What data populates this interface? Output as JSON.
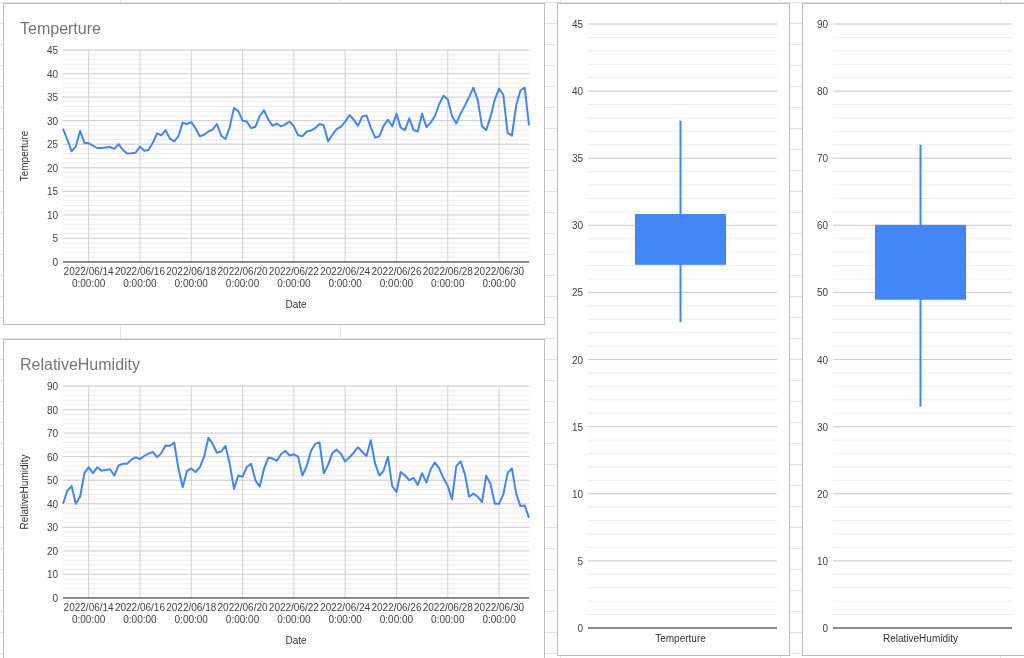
{
  "charts": [
    {
      "chart_data": {
        "type": "line",
        "grid": true,
        "title": "Temperture",
        "xlabel": "Date",
        "ylabel": "Temperture",
        "categories": [
          null,
          null,
          null,
          null,
          null,
          null,
          "2022/06/14 0:00:00",
          null,
          null,
          null,
          null,
          null,
          null,
          null,
          null,
          null,
          null,
          null,
          "2022/06/16 0:00:00",
          null,
          null,
          null,
          null,
          null,
          null,
          null,
          null,
          null,
          null,
          null,
          "2022/06/18 0:00:00",
          null,
          null,
          null,
          null,
          null,
          null,
          null,
          null,
          null,
          null,
          null,
          "2022/06/20 0:00:00",
          null,
          null,
          null,
          null,
          null,
          null,
          null,
          null,
          null,
          null,
          null,
          "2022/06/22 0:00:00",
          null,
          null,
          null,
          null,
          null,
          null,
          null,
          null,
          null,
          null,
          null,
          "2022/06/24 0:00:00",
          null,
          null,
          null,
          null,
          null,
          null,
          null,
          null,
          null,
          null,
          null,
          "2022/06/26 0:00:00",
          null,
          null,
          null,
          null,
          null,
          null,
          null,
          null,
          null,
          null,
          null,
          "2022/06/28 0:00:00",
          null,
          null,
          null,
          null,
          null,
          null,
          null,
          null,
          null,
          null,
          null,
          "2022/06/30 0:00:00",
          null,
          null,
          null,
          null,
          null,
          null,
          null
        ],
        "series": [
          {
            "color": "#4285f4",
            "values": [
              28.3,
              26,
              23.5,
              24.5,
              27.8,
              25.3,
              25.2,
              24.7,
              24.2,
              24.2,
              24.3,
              24.4,
              24,
              25,
              23.8,
              23,
              23.1,
              23.2,
              24.5,
              23.6,
              23.8,
              25.3,
              27.3,
              26.9,
              28,
              26.2,
              25.6,
              26.7,
              29.6,
              29.3,
              29.7,
              28.4,
              26.7,
              27,
              27.7,
              28.1,
              29.3,
              26.8,
              26.1,
              28.6,
              32.7,
              32,
              30,
              29.8,
              28.4,
              28.7,
              31,
              32.2,
              30.3,
              28.9,
              29.4,
              28.8,
              29.2,
              29.8,
              28.8,
              26.9,
              26.7,
              27.7,
              27.9,
              28.4,
              29.3,
              29,
              25.6,
              27,
              28.2,
              28.7,
              29.8,
              31.2,
              30.2,
              28.9,
              30.9,
              31.1,
              28.5,
              26.4,
              26.7,
              28.9,
              30.2,
              28.8,
              31.5,
              28.5,
              28,
              30.5,
              28,
              27.7,
              31.5,
              28.6,
              29.6,
              31,
              33.5,
              35.3,
              34.5,
              31,
              29.4,
              31.5,
              33.2,
              35,
              37,
              34.4,
              28.8,
              28,
              30.8,
              34.5,
              36.8,
              35.5,
              27.4,
              26.8,
              33.2,
              36.4,
              37,
              29
            ]
          }
        ],
        "ylim": [
          0,
          45
        ],
        "yticks": [
          0,
          5,
          10,
          15,
          20,
          25,
          30,
          35,
          40,
          45
        ]
      }
    },
    {
      "chart_data": {
        "type": "line",
        "grid": true,
        "title": "RelativeHumidity",
        "xlabel": "Date",
        "ylabel": "RelativeHumidity",
        "categories": [
          null,
          null,
          null,
          null,
          null,
          null,
          "2022/06/14 0:00:00",
          null,
          null,
          null,
          null,
          null,
          null,
          null,
          null,
          null,
          null,
          null,
          "2022/06/16 0:00:00",
          null,
          null,
          null,
          null,
          null,
          null,
          null,
          null,
          null,
          null,
          null,
          "2022/06/18 0:00:00",
          null,
          null,
          null,
          null,
          null,
          null,
          null,
          null,
          null,
          null,
          null,
          "2022/06/20 0:00:00",
          null,
          null,
          null,
          null,
          null,
          null,
          null,
          null,
          null,
          null,
          null,
          "2022/06/22 0:00:00",
          null,
          null,
          null,
          null,
          null,
          null,
          null,
          null,
          null,
          null,
          null,
          "2022/06/24 0:00:00",
          null,
          null,
          null,
          null,
          null,
          null,
          null,
          null,
          null,
          null,
          null,
          "2022/06/26 0:00:00",
          null,
          null,
          null,
          null,
          null,
          null,
          null,
          null,
          null,
          null,
          null,
          "2022/06/28 0:00:00",
          null,
          null,
          null,
          null,
          null,
          null,
          null,
          null,
          null,
          null,
          null,
          "2022/06/30 0:00:00",
          null,
          null,
          null,
          null,
          null,
          null,
          null
        ],
        "series": [
          {
            "color": "#4285f4",
            "values": [
              40,
              45.5,
              47.5,
              40,
              43,
              53,
              55.5,
              53,
              55.5,
              54,
              54.3,
              54.7,
              52,
              56.3,
              57,
              57,
              58.7,
              59.7,
              59,
              60.3,
              61.3,
              62,
              59.8,
              61.5,
              64.7,
              64.6,
              66,
              55,
              47,
              54,
              55,
              53.5,
              55.4,
              60,
              68,
              65.5,
              61.7,
              62.2,
              64.6,
              57,
              46.3,
              52,
              51.5,
              55.6,
              57,
              50,
              47.3,
              54.7,
              59.5,
              59.2,
              58.3,
              61,
              62.5,
              60.5,
              61,
              60,
              52,
              56,
              62.4,
              65.4,
              66,
              53,
              56.5,
              61.5,
              63,
              61.2,
              58,
              59.7,
              61.7,
              64,
              62,
              60.3,
              67,
              57,
              52,
              54,
              60,
              47.5,
              45,
              53.5,
              52,
              50,
              51,
              48,
              53,
              49,
              54.7,
              57.5,
              55,
              50.8,
              47.5,
              42,
              56,
              58,
              52.6,
              43,
              44.3,
              43,
              40.7,
              51.9,
              48.5,
              40,
              40,
              44,
              53,
              55,
              44.3,
              39,
              39.3,
              34
            ]
          }
        ],
        "ylim": [
          0,
          90
        ],
        "yticks": [
          0,
          10,
          20,
          30,
          40,
          50,
          60,
          70,
          80,
          90
        ]
      }
    },
    {
      "chart_data": {
        "type": "candlestick",
        "grid": true,
        "categories": [
          "Temperture"
        ],
        "series": [
          {
            "color": "#4285f4",
            "ohlc": [
              [
                27.1,
                37.8,
                22.8,
                30.8
              ]
            ]
          }
        ],
        "ylim": [
          0,
          45
        ],
        "yticks": [
          0,
          5,
          10,
          15,
          20,
          25,
          30,
          35,
          40,
          45
        ]
      }
    },
    {
      "chart_data": {
        "type": "candlestick",
        "grid": true,
        "categories": [
          "RelativeHumidity"
        ],
        "series": [
          {
            "color": "#4285f4",
            "ohlc": [
              [
                49,
                72,
                33,
                60
              ]
            ]
          }
        ],
        "ylim": [
          0,
          90
        ],
        "yticks": [
          0,
          10,
          20,
          30,
          40,
          50,
          60,
          70,
          80,
          90
        ]
      }
    }
  ]
}
